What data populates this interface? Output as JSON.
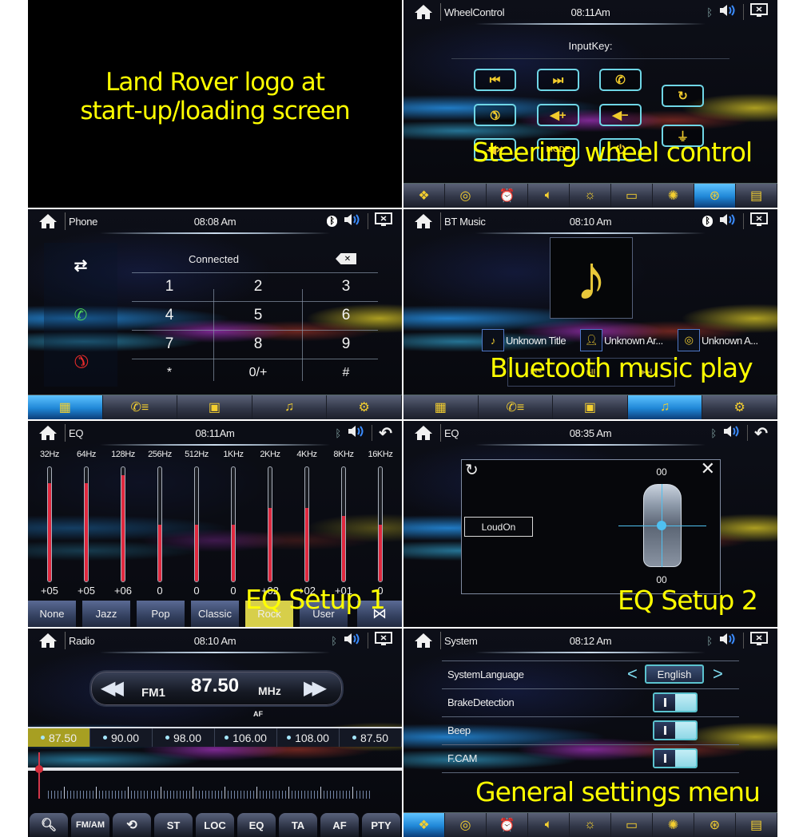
{
  "panels": {
    "loading": {
      "caption_line1": "Land Rover logo at",
      "caption_line2": "start-up/loading screen"
    },
    "wheel_control": {
      "title": "WheelControl",
      "time": "08:11Am",
      "input_key_label": "InputKey:",
      "buttons": [
        {
          "icon": "prev-track-icon",
          "glyph": "⏮"
        },
        {
          "icon": "next-track-icon",
          "glyph": "⏭"
        },
        {
          "icon": "phone-answer-icon",
          "glyph": "✆"
        },
        {
          "icon": "phone-hangup-icon",
          "glyph": "☎"
        },
        {
          "icon": "volume-up-icon",
          "glyph": "◀+"
        },
        {
          "icon": "volume-down-icon",
          "glyph": "◀−"
        },
        {
          "icon": "mute-icon",
          "glyph": "◀×"
        },
        {
          "label": "MODE"
        },
        {
          "icon": "power-icon",
          "glyph": "⏻"
        },
        {
          "icon": "reset-icon",
          "glyph": "↻"
        },
        {
          "icon": "antenna-icon",
          "glyph": "⏚"
        }
      ],
      "caption": "Steering wheel control",
      "nav_active_index": 7
    },
    "phone": {
      "title": "Phone",
      "time": "08:08 Am",
      "status": "Connected",
      "keys": [
        "1",
        "2",
        "3",
        "4",
        "5",
        "6",
        "7",
        "8",
        "9",
        "*",
        "0/+",
        "#"
      ],
      "nav_active_index": 0
    },
    "bt_music": {
      "title": "BT Music",
      "time": "08:10 Am",
      "track_title": "Unknown Title",
      "artist": "Unknown Ar...",
      "album": "Unknown A...",
      "caption": "Bluetooth music play",
      "nav_active_index": 3
    },
    "eq1": {
      "title": "EQ",
      "time": "08:11Am",
      "scale_min": -7,
      "scale_max": 7,
      "bands": [
        {
          "freq": "32Hz",
          "value": 5,
          "label": "+05"
        },
        {
          "freq": "64Hz",
          "value": 5,
          "label": "+05"
        },
        {
          "freq": "128Hz",
          "value": 6,
          "label": "+06"
        },
        {
          "freq": "256Hz",
          "value": 0,
          "label": "0"
        },
        {
          "freq": "512Hz",
          "value": 0,
          "label": "0"
        },
        {
          "freq": "1KHz",
          "value": 0,
          "label": "0"
        },
        {
          "freq": "2KHz",
          "value": 2,
          "label": "+02"
        },
        {
          "freq": "4KHz",
          "value": 2,
          "label": "+02"
        },
        {
          "freq": "8KHz",
          "value": 1,
          "label": "+01"
        },
        {
          "freq": "16KHz",
          "value": 0,
          "label": "0"
        }
      ],
      "presets": [
        "None",
        "Jazz",
        "Pop",
        "Classic",
        "Rock",
        "User"
      ],
      "selected_preset": "Rock",
      "caption": "EQ Setup 1"
    },
    "eq2": {
      "title": "EQ",
      "time": "08:35 Am",
      "loud_label": "LoudOn",
      "fader_top": "00",
      "fader_bottom": "00",
      "caption": "EQ Setup 2"
    },
    "radio": {
      "title": "Radio",
      "time": "08:10 Am",
      "band": "FM1",
      "frequency": "87.50",
      "unit": "MHz",
      "af_indicator": "AF",
      "presets": [
        "87.50",
        "90.00",
        "98.00",
        "106.00",
        "108.00",
        "87.50"
      ],
      "selected_preset_index": 0,
      "tuner_position": 0.0,
      "buttons": [
        "search",
        "FM/AM",
        "save",
        "ST",
        "LOC",
        "EQ",
        "TA",
        "AF",
        "PTY"
      ]
    },
    "system": {
      "title": "System",
      "time": "08:12 Am",
      "language_label": "SystemLanguage",
      "language_value": "English",
      "brake_label": "BrakeDetection",
      "beep_label": "Beep",
      "fcam_label": "F.CAM",
      "brake_on": false,
      "beep_on": false,
      "fcam_on": false,
      "caption": "General settings menu",
      "nav_active_index": 0
    }
  },
  "colors": {
    "accent_yellow": "#f4cf30",
    "caption_yellow": "#ffff00",
    "eq_fill": "#e0283e",
    "nav_active": "#1f86d6",
    "toggle_border": "#5bc3cf"
  }
}
